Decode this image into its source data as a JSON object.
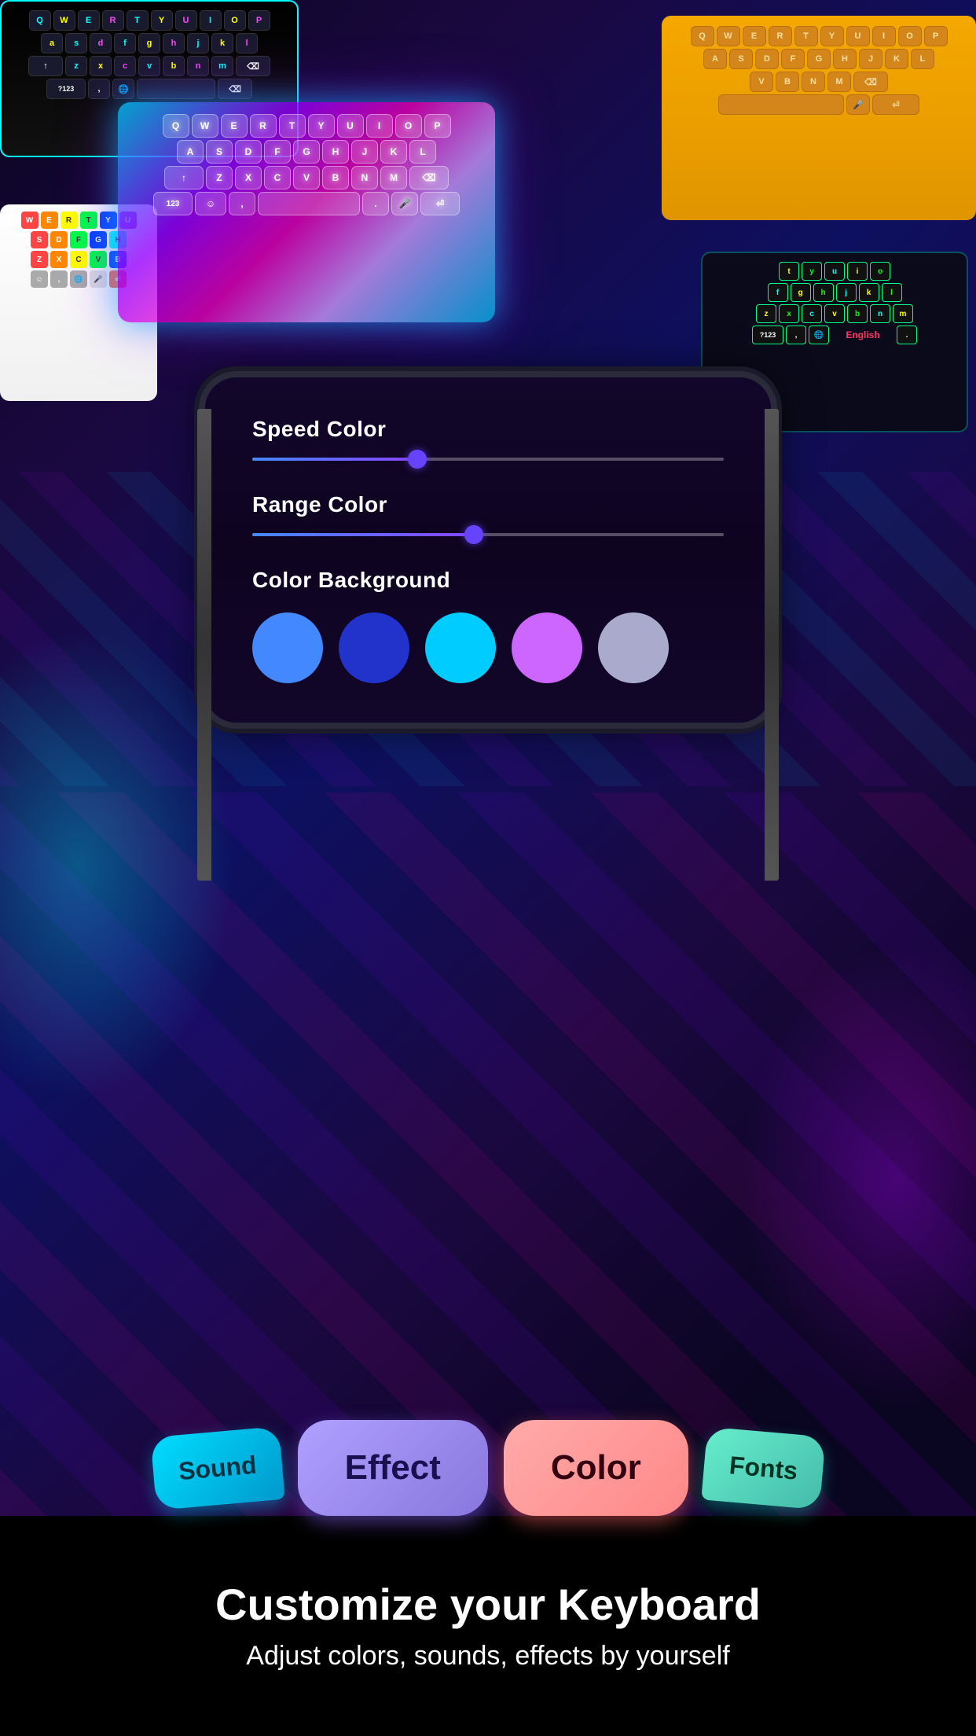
{
  "background": {
    "primary_color": "#0a0520",
    "accent_cyan": "#00ffff",
    "accent_purple": "#aa00ff",
    "accent_pink": "#ff00aa"
  },
  "keyboards": {
    "topleft": {
      "style": "dark_neon",
      "rows": [
        [
          "Q",
          "W",
          "E",
          "R",
          "T",
          "Y",
          "U",
          "I",
          "O",
          "P"
        ],
        [
          "A",
          "S",
          "D",
          "F",
          "G",
          "H",
          "J",
          "K",
          "L"
        ],
        [
          "↑",
          "Z",
          "X",
          "C",
          "V",
          "B",
          "N",
          "M",
          "⌫"
        ],
        [
          "?123",
          ",",
          "☺",
          "",
          "",
          "",
          "",
          "",
          "⏎"
        ]
      ]
    },
    "topright": {
      "style": "gold",
      "rows": [
        [
          "Q",
          "W",
          "E",
          "R",
          "T",
          "Y",
          "U",
          "I",
          "O",
          "P"
        ],
        [
          "A",
          "S",
          "D",
          "F",
          "G",
          "H",
          "J",
          "K",
          "L"
        ],
        [
          "V",
          "B",
          "N",
          "M",
          "⌫"
        ],
        [
          "🎤",
          "⏎"
        ]
      ]
    },
    "center": {
      "style": "holographic",
      "rows": [
        [
          "Q",
          "W",
          "E",
          "R",
          "T",
          "Y",
          "U",
          "I",
          "O",
          "P"
        ],
        [
          "A",
          "S",
          "D",
          "F",
          "G",
          "H",
          "J",
          "K",
          "L"
        ],
        [
          "↑",
          "Z",
          "X",
          "C",
          "V",
          "B",
          "N",
          "M",
          "⌫"
        ],
        [
          "123",
          "☺",
          ",",
          "",
          "",
          "🎤",
          "⏎"
        ]
      ]
    },
    "right": {
      "style": "dark_neon",
      "rows": [
        [
          "t",
          "y",
          "u",
          "i",
          "o"
        ],
        [
          "f",
          "g",
          "h",
          "j",
          "k",
          "l"
        ],
        [
          "z",
          "x",
          "c",
          "v",
          "b",
          "n",
          "m"
        ],
        [
          "?123",
          ",",
          "🌐",
          "English",
          ".",
          ""
        ]
      ]
    },
    "left": {
      "style": "rainbow_white",
      "rows": [
        [
          "W",
          "E",
          "R",
          "T",
          "Y",
          "U"
        ],
        [
          "S",
          "D",
          "F",
          "G",
          "H"
        ],
        [
          "Z",
          "X",
          "C",
          "V",
          "B"
        ],
        [
          "☺",
          ",",
          "🌐",
          "",
          "",
          "",
          "🎤",
          "⏎"
        ]
      ]
    }
  },
  "settings_panel": {
    "speed_color": {
      "label": "Speed Color",
      "slider_position": 0.35
    },
    "range_color": {
      "label": "Range Color",
      "slider_position": 0.47
    },
    "color_background": {
      "label": "Color Background",
      "colors": [
        {
          "name": "blue",
          "hex": "#4488ff"
        },
        {
          "name": "dark_blue",
          "hex": "#2233cc"
        },
        {
          "name": "cyan",
          "hex": "#00ccff"
        },
        {
          "name": "purple",
          "hex": "#cc66ff"
        },
        {
          "name": "light_purple",
          "hex": "#aaaacc"
        }
      ]
    }
  },
  "buttons": {
    "sound": "Sound",
    "effect": "Effect",
    "color": "Color",
    "fonts": "Fonts"
  },
  "bottom_text": {
    "headline": "Customize your Keyboard",
    "subline": "Adjust colors, sounds, effects by yourself"
  },
  "english_label": "English"
}
